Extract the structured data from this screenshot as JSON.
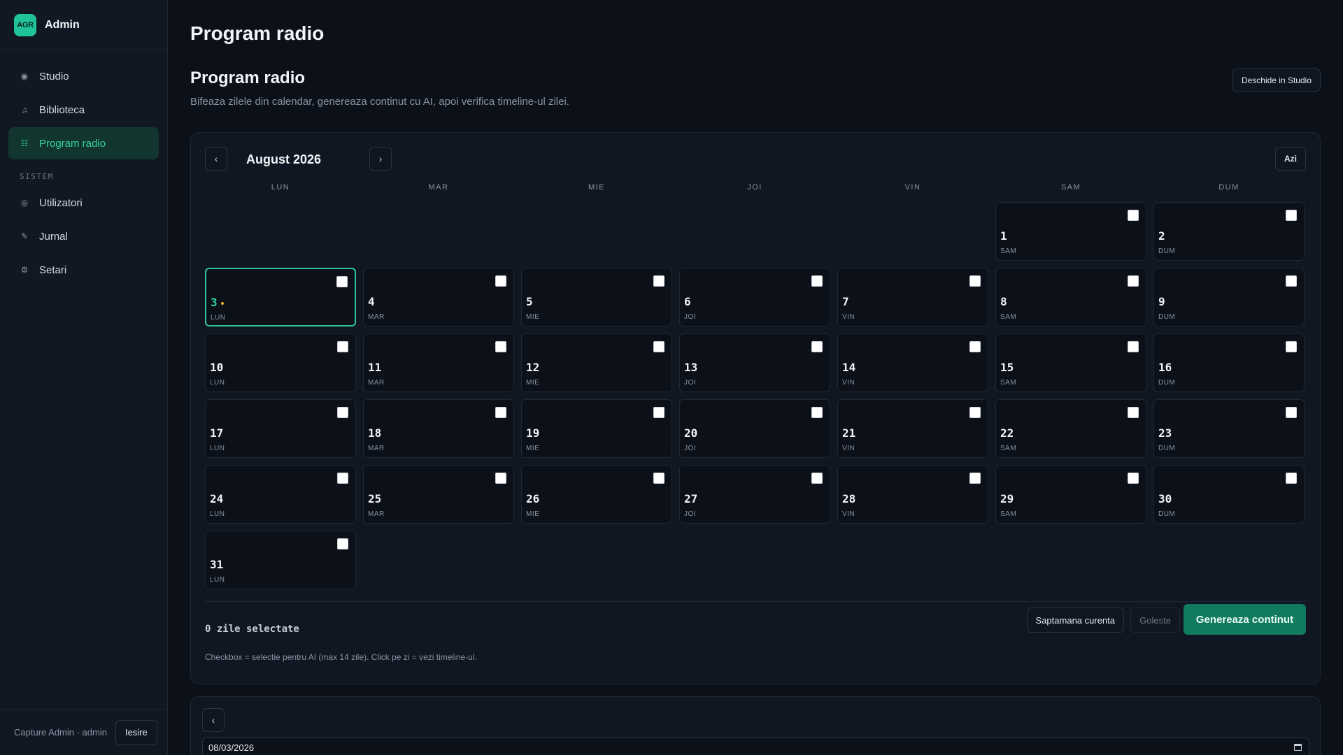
{
  "brand": {
    "logo": "AGR",
    "name": "Admin"
  },
  "sidebar": {
    "items": [
      {
        "label": "Studio",
        "icon": "radio-dot-icon",
        "glyph": "◉"
      },
      {
        "label": "Biblioteca",
        "icon": "music-note-icon",
        "glyph": "♫"
      },
      {
        "label": "Program radio",
        "icon": "list-icon",
        "glyph": "☷",
        "active": true
      }
    ],
    "section": "SISTEM",
    "system_items": [
      {
        "label": "Utilizatori",
        "icon": "users-circle-icon",
        "glyph": "◎"
      },
      {
        "label": "Jurnal",
        "icon": "pencil-icon",
        "glyph": "✎"
      },
      {
        "label": "Setari",
        "icon": "gear-icon",
        "glyph": "⚙"
      }
    ],
    "footer_user": "Capture Admin · admin",
    "exit_label": "Iesire"
  },
  "main": {
    "page_title": "Program radio",
    "section_title": "Program radio",
    "section_subtitle": "Bifeaza zilele din calendar, genereaza continut cu AI, apoi verifica timeline-ul zilei.",
    "studio_button": "Deschide in Studio"
  },
  "calendar": {
    "month_label": "August 2026",
    "prev": "‹",
    "next": "›",
    "today_label": "Azi",
    "weekdays": [
      "LUN",
      "MAR",
      "MIE",
      "JOI",
      "VIN",
      "SAM",
      "DUM"
    ],
    "first_weekday_index": 5,
    "days_in_month": 31,
    "today": 3,
    "selected_label": "0 zile selectate",
    "week_button": "Saptamana curenta",
    "clear_button": "Goleste",
    "generate_button": "Genereaza continut",
    "hint": "Checkbox = selectie pentru AI (max 14 zile). Click pe zi = vezi timeline-ul."
  },
  "timeline": {
    "back": "‹",
    "date_value": "08/03/2026"
  },
  "colors": {
    "accent": "#2cc79b",
    "today_dot": "#f0b429",
    "generate_bg": "#127a5f"
  }
}
